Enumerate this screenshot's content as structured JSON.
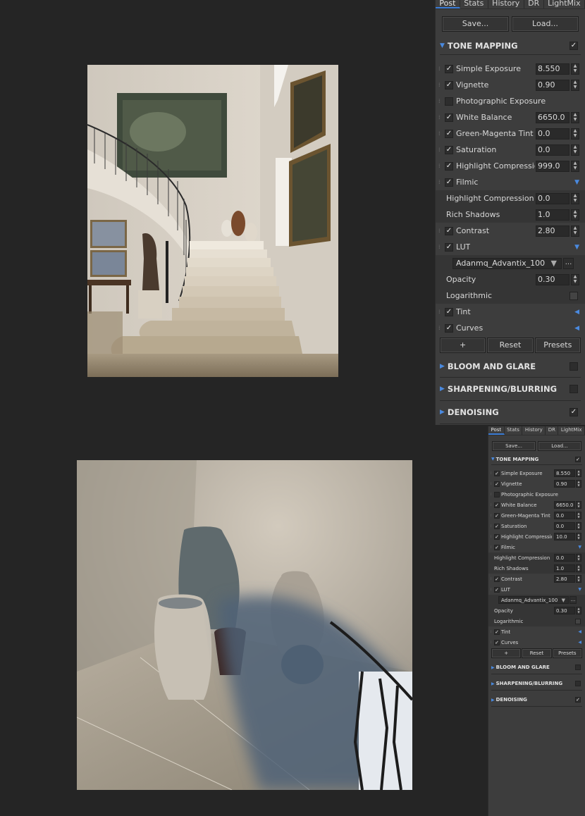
{
  "panel": {
    "tabs": [
      {
        "label": "Post",
        "active": true
      },
      {
        "label": "Stats"
      },
      {
        "label": "History"
      },
      {
        "label": "DR"
      },
      {
        "label": "LightMix"
      }
    ],
    "buttons": {
      "save": "Save...",
      "load": "Load..."
    },
    "tone_mapping": {
      "title": "TONE MAPPING",
      "enabled": true,
      "rows": {
        "simple_exposure": {
          "label": "Simple Exposure",
          "checked": true,
          "value": "8.550"
        },
        "vignette": {
          "label": "Vignette",
          "checked": true,
          "value": "0.90"
        },
        "photographic_exposure": {
          "label": "Photographic Exposure",
          "checked": false
        },
        "white_balance": {
          "label": "White Balance",
          "checked": true,
          "value": "6650.0"
        },
        "green_magenta_tint": {
          "label": "Green-Magenta Tint",
          "checked": true,
          "value": "0.0"
        },
        "saturation": {
          "label": "Saturation",
          "checked": true,
          "value": "0.0"
        },
        "highlight_compression": {
          "label": "Highlight Compressior",
          "checked": true
        },
        "filmic": {
          "label": "Filmic",
          "checked": true
        },
        "filmic_highlight_compression": {
          "label": "Highlight Compression",
          "value": "0.0"
        },
        "rich_shadows": {
          "label": "Rich Shadows",
          "value": "1.0"
        },
        "contrast": {
          "label": "Contrast",
          "checked": true,
          "value": "2.80"
        },
        "lut": {
          "label": "LUT",
          "checked": true
        },
        "lut_file": {
          "value": "Adanmq_Advantix_100",
          "browse": "..."
        },
        "opacity": {
          "label": "Opacity",
          "value": "0.30"
        },
        "logarithmic": {
          "label": "Logarithmic",
          "checked": false
        },
        "tint": {
          "label": "Tint",
          "checked": true
        },
        "curves": {
          "label": "Curves",
          "checked": true
        }
      },
      "curve_buttons": {
        "add": "+",
        "reset": "Reset",
        "presets": "Presets"
      }
    },
    "bloom": {
      "title": "BLOOM AND GLARE",
      "enabled": false
    },
    "sharpening": {
      "title": "SHARPENING/BLURRING",
      "enabled": false
    },
    "denoising": {
      "title": "DENOISING",
      "enabled": true
    }
  },
  "panel1_values": {
    "highlight_compression": "999.0"
  },
  "panel2_values": {
    "highlight_compression": "10.0"
  },
  "glyphs": {
    "check": "✓",
    "expand_down": "▼",
    "collapse_left": "◀",
    "section_open": "▼",
    "section_closed": "▶",
    "spin_up": "▲",
    "spin_down": "▼",
    "dropdown_arrow": "▼",
    "grip": "⁞"
  },
  "renders": [
    {
      "subject": "staircase-hall-render"
    },
    {
      "subject": "vases-corner-render"
    }
  ]
}
